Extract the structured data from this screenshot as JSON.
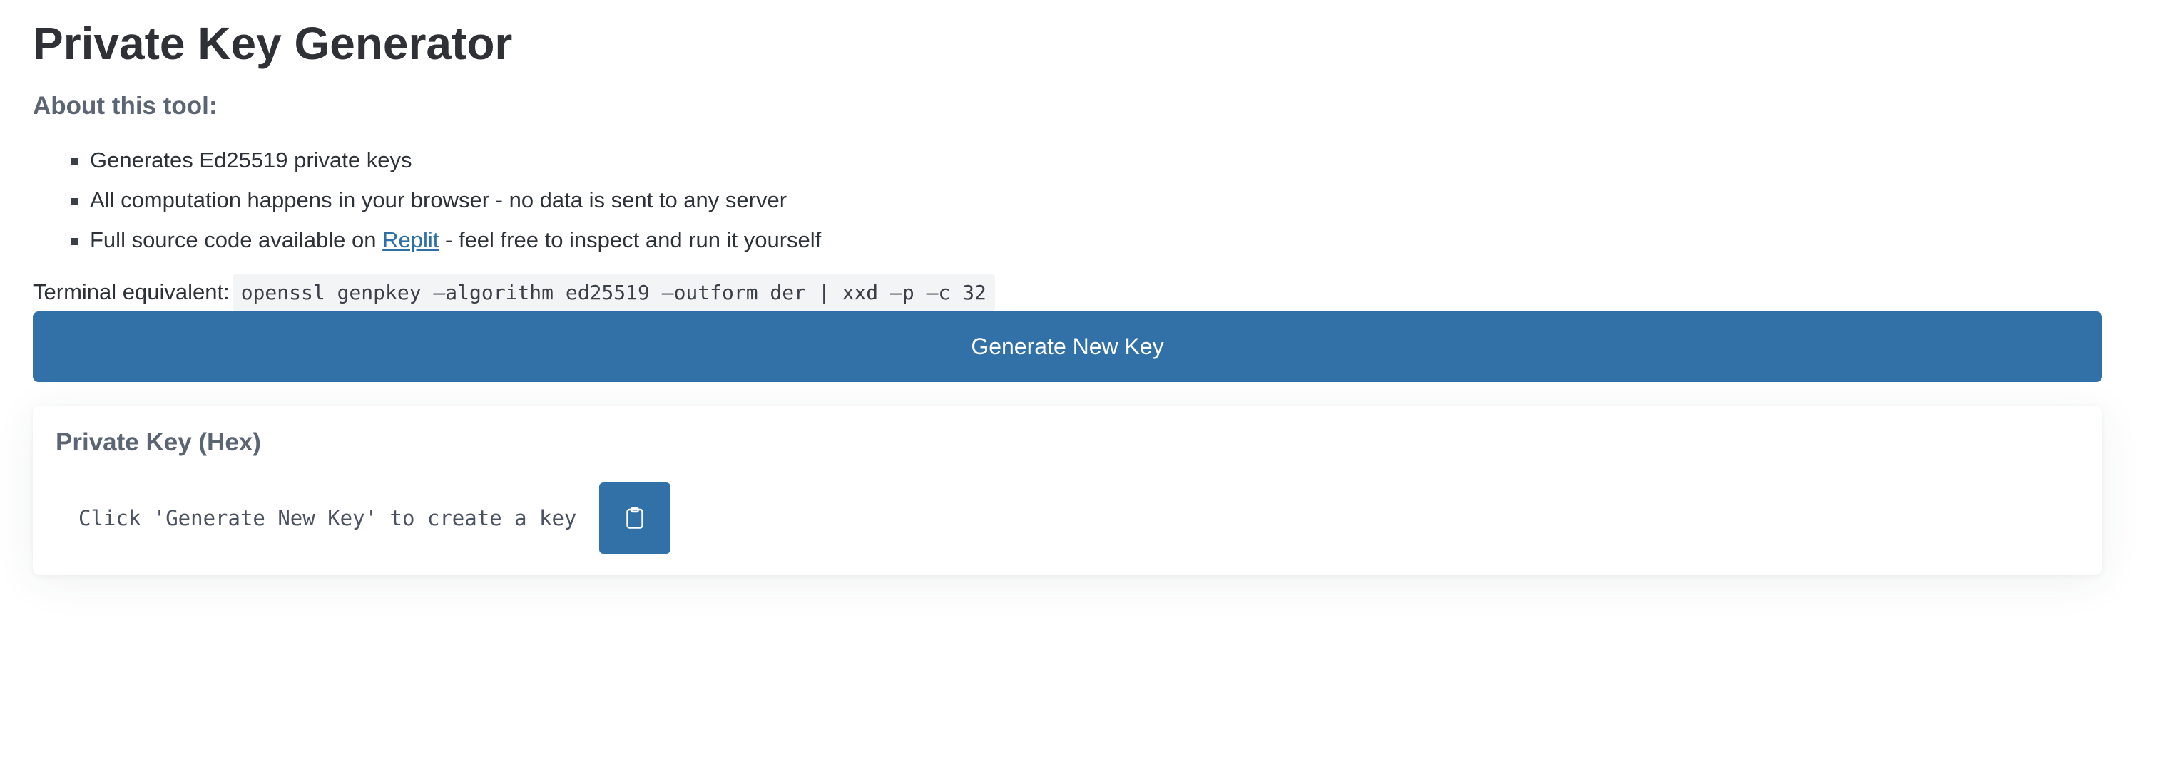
{
  "page": {
    "title": "Private Key Generator"
  },
  "about": {
    "heading": "About this tool:",
    "items": [
      {
        "text": "Generates Ed25519 private keys"
      },
      {
        "text": "All computation happens in your browser - no data is sent to any server"
      },
      {
        "prefix": "Full source code available on ",
        "link_label": "Replit",
        "suffix": " - feel free to inspect and run it yourself"
      }
    ]
  },
  "terminal": {
    "label": "Terminal equivalent:",
    "command": "openssl genpkey –algorithm ed25519 –outform der | xxd –p –c 32"
  },
  "generate": {
    "label": "Generate New Key"
  },
  "key_card": {
    "title": "Private Key (Hex)",
    "output": "Click 'Generate New Key' to create a key",
    "copy_icon": "clipboard-icon"
  },
  "colors": {
    "accent": "#3270a8",
    "link": "#2f6fa8",
    "heading_muted": "#5b6573"
  }
}
